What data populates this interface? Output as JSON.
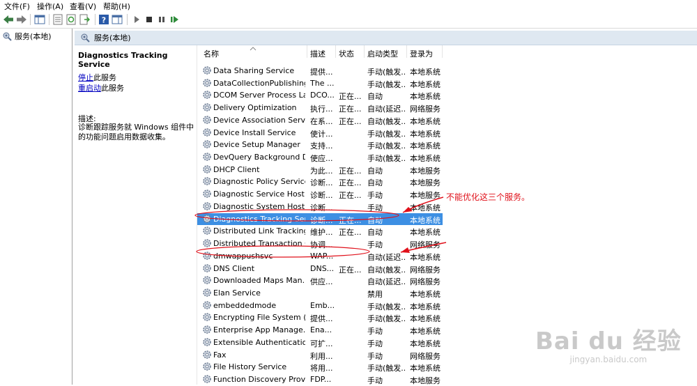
{
  "menu": [
    "文件(F)",
    "操作(A)",
    "查看(V)",
    "帮助(H)"
  ],
  "tree": {
    "item": "服务(本地)"
  },
  "panel": {
    "title": "服务(本地)"
  },
  "detail": {
    "service_name": "Diagnostics Tracking Service",
    "stop_link": "停止",
    "stop_rest": "此服务",
    "restart_link": "重启动",
    "restart_rest": "此服务",
    "desc_label": "描述:",
    "description": "诊断跟踪服务就 Windows 组件中的功能问题启用数据收集。"
  },
  "columns": {
    "name": "名称",
    "desc": "描述",
    "status": "状态",
    "startup": "启动类型",
    "logon": "登录为"
  },
  "rows": [
    {
      "name": "Data Sharing Service",
      "desc": "提供...",
      "status": "",
      "startup": "手动(触发...",
      "logon": "本地系统"
    },
    {
      "name": "DataCollectionPublishing...",
      "desc": "The ...",
      "status": "",
      "startup": "手动(触发...",
      "logon": "本地系统"
    },
    {
      "name": "DCOM Server Process La...",
      "desc": "DCO...",
      "status": "正在...",
      "startup": "自动",
      "logon": "本地系统"
    },
    {
      "name": "Delivery Optimization",
      "desc": "执行...",
      "status": "正在...",
      "startup": "自动(延迟...",
      "logon": "网络服务"
    },
    {
      "name": "Device Association Service",
      "desc": "在系...",
      "status": "正在...",
      "startup": "自动(触发...",
      "logon": "本地系统"
    },
    {
      "name": "Device Install Service",
      "desc": "使计...",
      "status": "",
      "startup": "手动(触发...",
      "logon": "本地系统"
    },
    {
      "name": "Device Setup Manager",
      "desc": "支持...",
      "status": "",
      "startup": "手动(触发...",
      "logon": "本地系统"
    },
    {
      "name": "DevQuery Background D...",
      "desc": "使应...",
      "status": "",
      "startup": "手动(触发...",
      "logon": "本地系统"
    },
    {
      "name": "DHCP Client",
      "desc": "为此...",
      "status": "正在...",
      "startup": "自动",
      "logon": "本地服务"
    },
    {
      "name": "Diagnostic Policy Service",
      "desc": "诊断...",
      "status": "正在...",
      "startup": "自动",
      "logon": "本地服务"
    },
    {
      "name": "Diagnostic Service Host",
      "desc": "诊断...",
      "status": "正在...",
      "startup": "手动",
      "logon": "本地服务"
    },
    {
      "name": "Diagnostic System Host",
      "desc": "诊断...",
      "status": "",
      "startup": "手动",
      "logon": "本地系统"
    },
    {
      "name": "Diagnostics Tracking Ser...",
      "desc": "诊断...",
      "status": "正在...",
      "startup": "自动",
      "logon": "本地系统"
    },
    {
      "name": "Distributed Link Tracking...",
      "desc": "维护...",
      "status": "正在...",
      "startup": "自动",
      "logon": "本地系统"
    },
    {
      "name": "Distributed Transaction C...",
      "desc": "协调...",
      "status": "",
      "startup": "手动",
      "logon": "网络服务"
    },
    {
      "name": "dmwappushsvc",
      "desc": "WAP...",
      "status": "",
      "startup": "自动(延迟...",
      "logon": "本地系统"
    },
    {
      "name": "DNS Client",
      "desc": "DNS...",
      "status": "正在...",
      "startup": "自动(触发...",
      "logon": "网络服务"
    },
    {
      "name": "Downloaded Maps Man...",
      "desc": "供应...",
      "status": "",
      "startup": "自动(延迟...",
      "logon": "网络服务"
    },
    {
      "name": "Elan Service",
      "desc": "",
      "status": "",
      "startup": "禁用",
      "logon": "本地系统"
    },
    {
      "name": "embeddedmode",
      "desc": "Emb...",
      "status": "",
      "startup": "手动(触发...",
      "logon": "本地系统"
    },
    {
      "name": "Encrypting File System (E...",
      "desc": "提供...",
      "status": "",
      "startup": "手动(触发...",
      "logon": "本地系统"
    },
    {
      "name": "Enterprise App Manage...",
      "desc": "Ena...",
      "status": "",
      "startup": "手动",
      "logon": "本地系统"
    },
    {
      "name": "Extensible Authenticatio...",
      "desc": "可扩...",
      "status": "",
      "startup": "手动",
      "logon": "本地系统"
    },
    {
      "name": "Fax",
      "desc": "利用...",
      "status": "",
      "startup": "手动",
      "logon": "网络服务"
    },
    {
      "name": "File History Service",
      "desc": "将用...",
      "status": "",
      "startup": "手动(触发...",
      "logon": "本地系统"
    },
    {
      "name": "Function Discovery Provi...",
      "desc": "FDP...",
      "status": "",
      "startup": "手动",
      "logon": "本地服务"
    }
  ],
  "annotation": {
    "text": "不能优化这三个服务。",
    "color": "#e0101a"
  },
  "watermark": {
    "main": "Bai du 经验",
    "sub": "jingyan.baidu.com"
  },
  "selection_color": "#3d8fe3"
}
